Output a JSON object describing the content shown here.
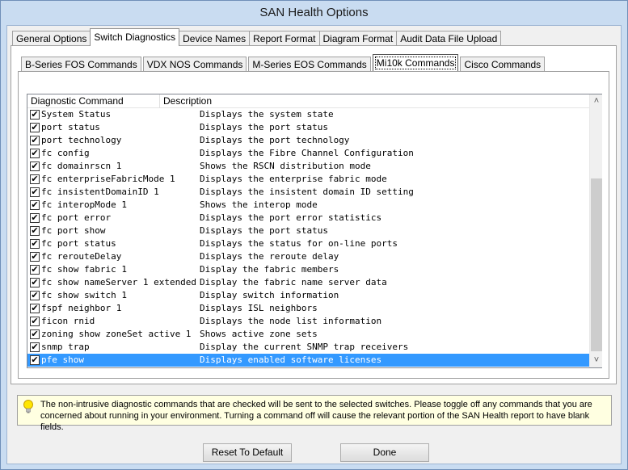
{
  "window": {
    "title": "SAN Health Options"
  },
  "tabs": [
    "General Options",
    "Switch Diagnostics",
    "Device Names",
    "Report Format",
    "Diagram Format",
    "Audit Data File Upload"
  ],
  "subtabs": [
    "B-Series FOS Commands",
    "VDX NOS Commands",
    "M-Series EOS Commands",
    "Mi10k Commands",
    "Cisco Commands"
  ],
  "list": {
    "columns": [
      "Diagnostic Command",
      "Description"
    ],
    "rows": [
      {
        "cmd": "System Status",
        "desc": "Displays the system state",
        "checked": true
      },
      {
        "cmd": "port status",
        "desc": "Displays the port status",
        "checked": true
      },
      {
        "cmd": "port technology",
        "desc": "Displays the port technology",
        "checked": true
      },
      {
        "cmd": "fc config",
        "desc": "Displays the Fibre Channel Configuration",
        "checked": true
      },
      {
        "cmd": "fc domainrscn 1",
        "desc": "Shows the RSCN distribution mode",
        "checked": true
      },
      {
        "cmd": "fc enterpriseFabricMode 1",
        "desc": "Displays the enterprise fabric mode",
        "checked": true
      },
      {
        "cmd": "fc insistentDomainID 1",
        "desc": "Displays the insistent domain ID setting",
        "checked": true
      },
      {
        "cmd": "fc interopMode 1",
        "desc": "Shows the interop mode",
        "checked": true
      },
      {
        "cmd": "fc port error",
        "desc": "Displays the port error statistics",
        "checked": true
      },
      {
        "cmd": "fc port show",
        "desc": "Displays the port status",
        "checked": true
      },
      {
        "cmd": "fc port status",
        "desc": "Displays the status for on-line ports",
        "checked": true
      },
      {
        "cmd": "fc rerouteDelay",
        "desc": "Displays the reroute delay",
        "checked": true
      },
      {
        "cmd": "fc show fabric 1",
        "desc": "Display the fabric members",
        "checked": true
      },
      {
        "cmd": "fc show nameServer 1 extended",
        "desc": "Display the fabric name server data",
        "checked": true
      },
      {
        "cmd": "fc show switch 1",
        "desc": "Display switch information",
        "checked": true
      },
      {
        "cmd": "fspf neighbor 1",
        "desc": "Displays ISL neighbors",
        "checked": true
      },
      {
        "cmd": "ficon rnid",
        "desc": "Displays the node list information",
        "checked": true
      },
      {
        "cmd": "zoning show zoneSet active 1",
        "desc": "Shows active zone sets",
        "checked": true
      },
      {
        "cmd": "snmp trap",
        "desc": "Display the current SNMP trap receivers",
        "checked": true
      },
      {
        "cmd": "pfe show",
        "desc": "Displays enabled software licenses",
        "checked": true,
        "selected": true
      }
    ]
  },
  "info": {
    "text": "The non-intrusive diagnostic commands that are checked will be sent to the selected switches.  Please toggle off any commands that you are concerned about running in your environment.  Turning a command off will cause the relevant portion of the SAN Health report to have blank fields."
  },
  "buttons": {
    "reset": "Reset To Default",
    "done": "Done"
  }
}
